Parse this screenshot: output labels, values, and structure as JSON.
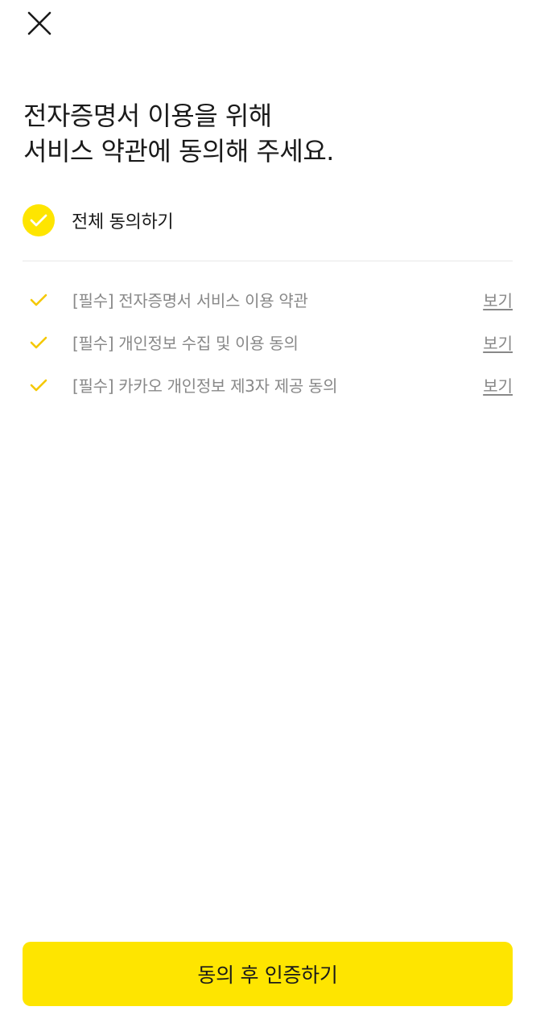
{
  "header": {
    "close_icon": "close-icon"
  },
  "title": {
    "line1": "전자증명서 이용을 위해",
    "line2": "서비스 약관에 동의해 주세요."
  },
  "agree_all": {
    "label": "전체 동의하기",
    "checked": true,
    "icon": "check-circle-icon"
  },
  "terms": [
    {
      "label": "[필수] 전자증명서 서비스 이용 약관",
      "view_label": "보기",
      "checked": true
    },
    {
      "label": "[필수] 개인정보 수집 및 이용 동의",
      "view_label": "보기",
      "checked": true
    },
    {
      "label": "[필수] 카카오 개인정보 제3자 제공 동의",
      "view_label": "보기",
      "checked": true
    }
  ],
  "submit": {
    "label": "동의 후 인증하기"
  },
  "colors": {
    "accent": "#fee500",
    "check": "#f5c800",
    "muted_text": "#888888",
    "text": "#1a1a1a",
    "divider": "#e8e8e8"
  }
}
